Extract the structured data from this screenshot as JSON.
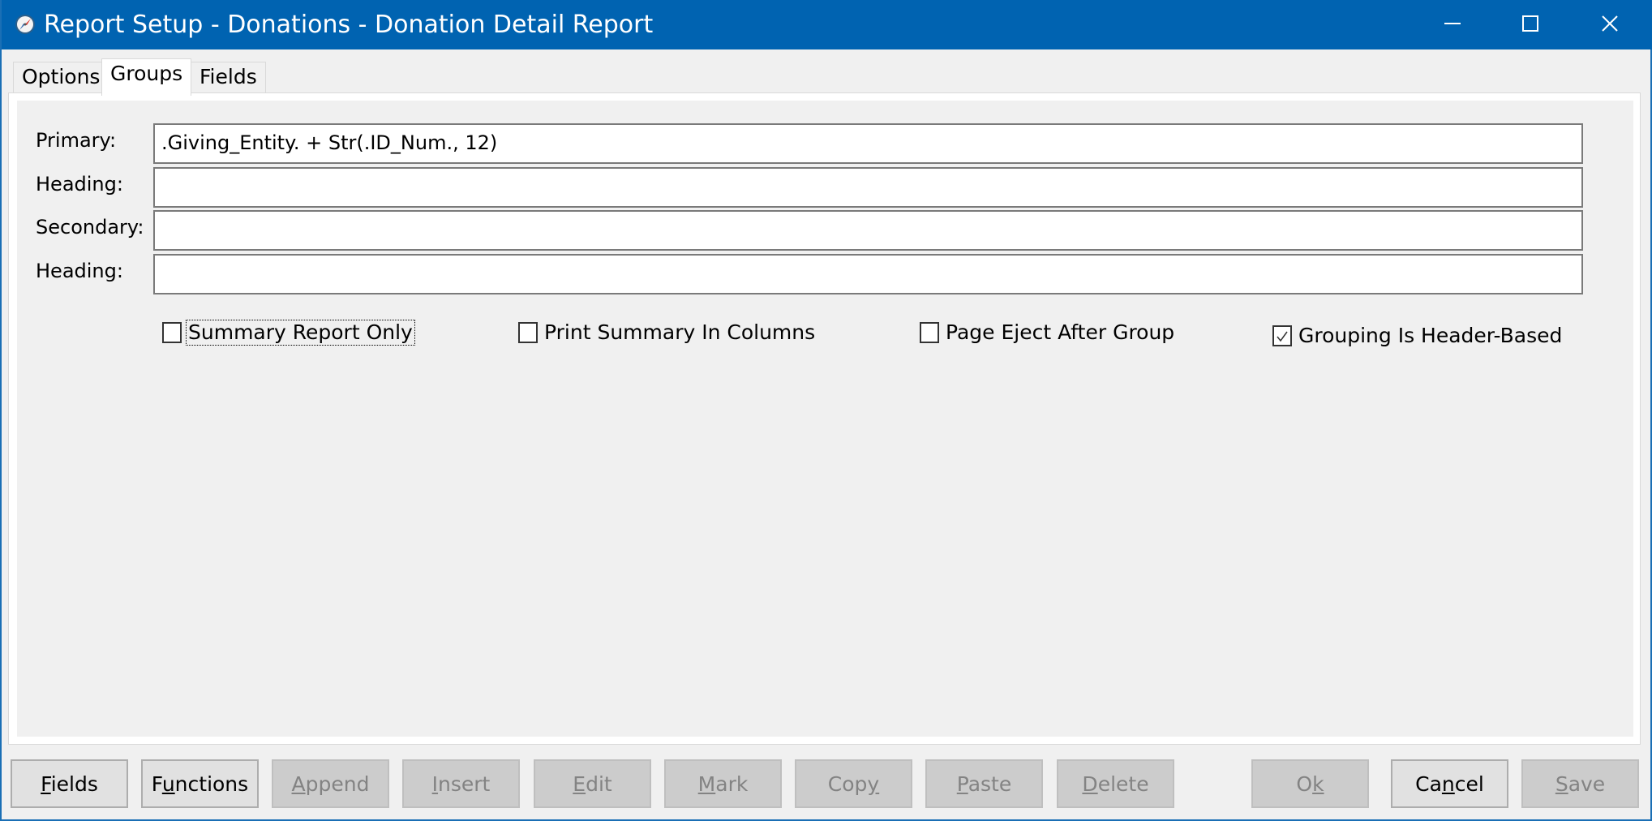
{
  "window": {
    "title": "Report Setup - Donations - Donation Detail Report",
    "app_icon": "compass-icon",
    "controls": {
      "minimize": "minimize-icon",
      "maximize": "maximize-icon",
      "close": "close-icon"
    }
  },
  "tabs": [
    {
      "label": "Options",
      "active": false
    },
    {
      "label": "Groups",
      "active": true
    },
    {
      "label": "Fields",
      "active": false
    }
  ],
  "groups": {
    "rows": [
      {
        "label": "Primary:",
        "value": ".Giving_Entity. + Str(.ID_Num., 12)"
      },
      {
        "label": "Heading:",
        "value": ""
      },
      {
        "label": "Secondary:",
        "value": ""
      },
      {
        "label": "Heading:",
        "value": ""
      }
    ],
    "checkboxes": [
      {
        "label": "Summary Report Only",
        "checked": false,
        "focused": true
      },
      {
        "label": "Print Summary In Columns",
        "checked": false,
        "focused": false
      },
      {
        "label": "Page Eject After Group",
        "checked": false,
        "focused": false
      },
      {
        "label": "Grouping Is Header-Based",
        "checked": true,
        "focused": false
      }
    ]
  },
  "buttons": [
    {
      "label": "Fields",
      "mnemonic_index": 0,
      "enabled": true
    },
    {
      "label": "Functions",
      "mnemonic_index": 1,
      "enabled": true
    },
    {
      "label": "Append",
      "mnemonic_index": 0,
      "enabled": false
    },
    {
      "label": "Insert",
      "mnemonic_index": 0,
      "enabled": false
    },
    {
      "label": "Edit",
      "mnemonic_index": 0,
      "enabled": false
    },
    {
      "label": "Mark",
      "mnemonic_index": 0,
      "enabled": false
    },
    {
      "label": "Copy",
      "mnemonic_index": 3,
      "enabled": false
    },
    {
      "label": "Paste",
      "mnemonic_index": 0,
      "enabled": false
    },
    {
      "label": "Delete",
      "mnemonic_index": 0,
      "enabled": false
    },
    {
      "label": "Ok",
      "mnemonic_index": 1,
      "enabled": false
    },
    {
      "label": "Cancel",
      "mnemonic_index": 2,
      "enabled": true
    },
    {
      "label": "Save",
      "mnemonic_index": 0,
      "enabled": false
    }
  ]
}
